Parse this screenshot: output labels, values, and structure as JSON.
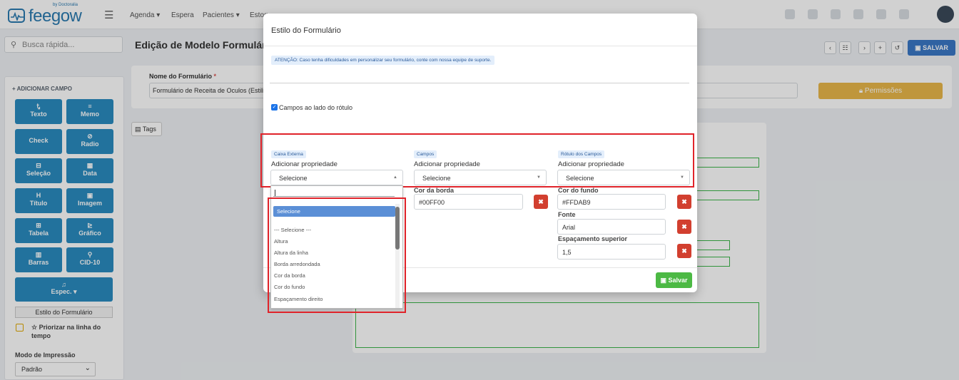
{
  "topbar": {
    "logo_text": "feegow",
    "logo_sub": "by Doctoralia",
    "nav": [
      "Agenda ▾",
      "Espera",
      "Pacientes ▾",
      "Estoq"
    ]
  },
  "sidebar": {
    "search_placeholder": "Busca rápida...",
    "add_field_title": "+ ADICIONAR CAMPO",
    "field_buttons": [
      {
        "icon": "Ꮏ",
        "label": "Texto"
      },
      {
        "icon": "≡",
        "label": "Memo"
      },
      {
        "icon": "",
        "label": "Check"
      },
      {
        "icon": "⊘",
        "label": "Radio"
      },
      {
        "icon": "⊟",
        "label": "Seleção"
      },
      {
        "icon": "▦",
        "label": "Data"
      },
      {
        "icon": "H",
        "label": "Título"
      },
      {
        "icon": "▣",
        "label": "Imagem"
      },
      {
        "icon": "⊞",
        "label": "Tabela"
      },
      {
        "icon": "⊵",
        "label": "Gráfico"
      },
      {
        "icon": "▥",
        "label": "Barras"
      },
      {
        "icon": "⚲",
        "label": "CID-10"
      }
    ],
    "espec_label": "Espec. ▾",
    "estilo_label": "Estilo do Formulário",
    "priorizar_label": "☆ Priorizar na linha do tempo",
    "modo_label": "Modo de Impressão",
    "modo_value": "Padrão"
  },
  "main": {
    "title": "Edição de Modelo Formulário",
    "salvar_label": "SALVAR",
    "nome_label": "Nome do Formulário",
    "nome_value": "Formulário de Receita de Oculos (Estilizado)",
    "permissoes_label": "Permissões",
    "tags_label": "Tags"
  },
  "modal": {
    "title": "Estilo do Formulário",
    "alert": "ATENÇÃO: Caso tenha dificuldades em personalizar seu formulário, conte com nossa equipe de suporte.",
    "checkbox_label": "Campos ao lado do rótulo",
    "columns": [
      {
        "badge": "Caixa Externa",
        "add_label": "Adicionar propriedade",
        "select": "Selecione"
      },
      {
        "badge": "Campos",
        "add_label": "Adicionar propriedade",
        "select": "Selecione"
      },
      {
        "badge": "Rótulo dos Campos",
        "add_label": "Adicionar propriedade",
        "select": "Selecione"
      }
    ],
    "campos_props": [
      {
        "label": "Cor da borda",
        "value": "#00FF00"
      }
    ],
    "rotulo_props": [
      {
        "label": "Cor do fundo",
        "value": "#FFDAB9"
      },
      {
        "label": "Fonte",
        "value": "Arial"
      },
      {
        "label": "Espaçamento superior",
        "value": "1,5"
      }
    ],
    "save_label": "Salvar"
  },
  "dropdown": {
    "search_value": "",
    "selected": "Selecione",
    "options": [
      "--- Selecione ---",
      "Altura",
      "Altura da linha",
      "Borda arredondada",
      "Cor da borda",
      "Cor do fundo",
      "Espaçamento direito"
    ]
  },
  "colors": {
    "accent": "#2a8cc0",
    "danger": "#d23f2f",
    "success": "#4cb944",
    "highlight": "#e0232a"
  }
}
